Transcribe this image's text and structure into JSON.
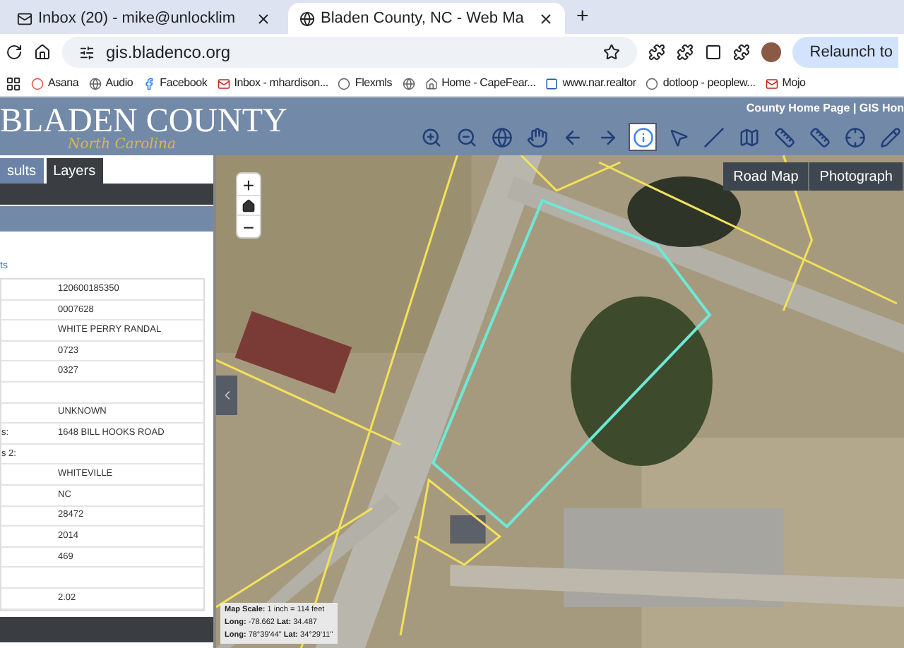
{
  "browser": {
    "tabs": [
      {
        "title": "Inbox (20) - mike@unlocklim",
        "selected": false
      },
      {
        "title": "Bladen County, NC - Web Ma",
        "selected": true
      }
    ],
    "new_tab": "+",
    "address": "gis.bladenco.org",
    "relaunch": "Relaunch to",
    "bookmarks": [
      {
        "label": "Asana"
      },
      {
        "label": "Audio"
      },
      {
        "label": "Facebook"
      },
      {
        "label": "Inbox - mhardison..."
      },
      {
        "label": "Flexmls"
      },
      {
        "label": "Home - CapeFear..."
      },
      {
        "label": "www.nar.realtor"
      },
      {
        "label": "dotloop - peoplew..."
      },
      {
        "label": "Mojo"
      }
    ]
  },
  "header": {
    "logo_title": "BLADEN COUNTY",
    "logo_subtitle": "North Carolina",
    "links": "County Home Page | GIS Hon",
    "tools": [
      {
        "kind": "zoom-in",
        "selected": false
      },
      {
        "kind": "zoom-out",
        "selected": false
      },
      {
        "kind": "globe",
        "selected": false
      },
      {
        "kind": "hand",
        "selected": false
      },
      {
        "kind": "back",
        "selected": false
      },
      {
        "kind": "forward",
        "selected": false
      },
      {
        "kind": "info",
        "selected": true
      },
      {
        "kind": "pointer",
        "selected": false
      },
      {
        "kind": "line",
        "selected": false
      },
      {
        "kind": "map",
        "selected": false
      },
      {
        "kind": "ruler",
        "selected": false
      },
      {
        "kind": "ruler",
        "selected": false
      },
      {
        "kind": "xy",
        "selected": false
      },
      {
        "kind": "pencil",
        "selected": false
      }
    ]
  },
  "panel": {
    "tabs": [
      {
        "label": "sults",
        "selected": true
      },
      {
        "label": "Layers",
        "selected": false
      }
    ],
    "link": "ts",
    "rows": [
      {
        "label": "",
        "value": "120600185350"
      },
      {
        "label": "",
        "value": "0007628"
      },
      {
        "label": "",
        "value": "WHITE PERRY RANDAL"
      },
      {
        "label": "",
        "value": "0723"
      },
      {
        "label": "",
        "value": "0327"
      },
      {
        "label": "",
        "value": ""
      },
      {
        "label": "",
        "value": "UNKNOWN"
      },
      {
        "label": "s:",
        "value": "1648 BILL HOOKS ROAD"
      },
      {
        "label": "s 2:",
        "value": ""
      },
      {
        "label": "",
        "value": "WHITEVILLE"
      },
      {
        "label": "",
        "value": "NC"
      },
      {
        "label": "",
        "value": "28472"
      },
      {
        "label": "",
        "value": "2014"
      },
      {
        "label": "",
        "value": "469"
      },
      {
        "label": "",
        "value": ""
      },
      {
        "label": "",
        "value": "2.02"
      }
    ]
  },
  "map": {
    "zoom_in": "+",
    "zoom_out": "−",
    "basemaps": [
      {
        "label": "Road Map",
        "selected": false
      },
      {
        "label": "Photograph",
        "selected": false
      }
    ],
    "scale": [
      {
        "label": "Map Scale:",
        "value": "1 inch = 114 feet"
      },
      {
        "label": "Long:",
        "value": "-78.662",
        "label2": "Lat:",
        "value2": "34.487"
      },
      {
        "label": "Long:",
        "value": "78°39'44\"",
        "label2": "Lat:",
        "value2": "34°29'11\""
      }
    ]
  }
}
